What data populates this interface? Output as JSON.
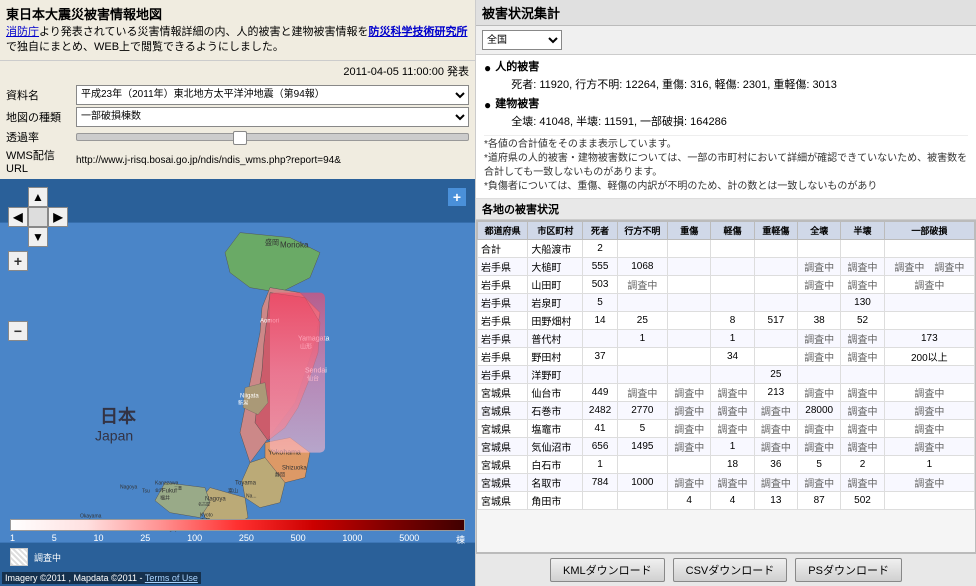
{
  "app": {
    "title": "東日本大震災被害情報地図",
    "description_part1": "消防庁",
    "description_part2": "より発表されている災害情報詳細の内、人的被害と建物被害情報を",
    "description_part3": "防災科学技術研究所",
    "description_part4": "で独自にまとめ、WEB上で閲覧できるようにしました。",
    "date_line": "2011-04-05 11:00:00 発表",
    "form": {
      "data_name_label": "資料名",
      "data_name_value": "平成23年（2011年）東北地方太平洋沖地震（第94報）",
      "map_type_label": "地図の種類",
      "map_type_value": "一部破損棟数",
      "transparency_label": "透過率",
      "wms_label": "WMS配信URL",
      "wms_url": "http://www.j-risq.bosai.go.jp/ndis/ndis_wms.php?report=94&"
    },
    "imagery_credit": "Imagery ©2011 , Mapdata ©2011 - ",
    "terms_link": "Terms of Use",
    "legend_labels": [
      "1",
      "5",
      "10",
      "25",
      "100",
      "250",
      "500",
      "1000",
      "5000",
      "棟"
    ],
    "legend_investigating": "調査中"
  },
  "stats": {
    "header": "被害状況集計",
    "filter_label": "全国",
    "human_damage_header": "人的被害",
    "human_damage_detail": "死者: 11920, 行方不明: 12264, 重傷: 316, 軽傷: 2301, 重軽傷: 3013",
    "building_damage_header": "建物被害",
    "building_damage_detail": "全壊: 41048, 半壊: 11591, 一部破損: 164286",
    "notes": [
      "*各値の合計値をそのまま表示しています。",
      "*道府県の人的被害・建物被害数については、一部の市町村において詳細が確認できていないため、被害数を合計しても一致しないものがあります。",
      "*負傷者については、重傷、軽傷の内訳が不明のため、計の数とは一致しないものがあり"
    ],
    "table_header": "各地の被害状況",
    "columns": [
      "都道府県",
      "市区町村",
      "死者",
      "行方不明",
      "重傷",
      "軽傷",
      "重軽傷",
      "全壊",
      "半壊",
      "一部破損"
    ],
    "rows": [
      [
        "合計",
        "大船渡市",
        "2",
        "",
        "",
        "",
        "",
        "",
        "",
        ""
      ],
      [
        "岩手県",
        "大槌町",
        "555",
        "1068",
        "",
        "",
        "",
        "調査中",
        "調査中",
        "調査中　調査中"
      ],
      [
        "岩手県",
        "山田町",
        "503",
        "調査中",
        "",
        "",
        "",
        "調査中",
        "調査中",
        "調査中"
      ],
      [
        "岩手県",
        "岩泉町",
        "5",
        "",
        "",
        "",
        "",
        "",
        "130",
        ""
      ],
      [
        "岩手県",
        "田野畑村",
        "14",
        "25",
        "",
        "8",
        "517",
        "38",
        "52",
        ""
      ],
      [
        "岩手県",
        "普代村",
        "",
        "1",
        "",
        "1",
        "",
        "調査中",
        "調査中",
        "173"
      ],
      [
        "岩手県",
        "野田村",
        "37",
        "",
        "",
        "34",
        "",
        "調査中",
        "調査中",
        "200以上"
      ],
      [
        "岩手県",
        "洋野町",
        "",
        "",
        "",
        "",
        "25",
        "",
        "",
        ""
      ],
      [
        "宮城県",
        "仙台市",
        "449",
        "調査中",
        "調査中",
        "調査中",
        "213",
        "調査中",
        "調査中",
        "調査中"
      ],
      [
        "宮城県",
        "石巻市",
        "2482",
        "2770",
        "調査中",
        "調査中",
        "調査中",
        "28000",
        "調査中",
        "調査中"
      ],
      [
        "宮城県",
        "塩竈市",
        "41",
        "5",
        "調査中",
        "調査中",
        "調査中",
        "調査中",
        "調査中",
        "調査中"
      ],
      [
        "宮城県",
        "気仙沼市",
        "656",
        "1495",
        "調査中",
        "1",
        "調査中",
        "調査中",
        "調査中",
        "調査中"
      ],
      [
        "宮城県",
        "白石市",
        "1",
        "",
        "",
        "18",
        "36",
        "5",
        "2",
        "1"
      ],
      [
        "宮城県",
        "名取市",
        "784",
        "1000",
        "調査中",
        "調査中",
        "調査中",
        "調査中",
        "調査中",
        "調査中"
      ],
      [
        "宮城県",
        "角田市",
        "",
        "",
        "4",
        "4",
        "13",
        "87",
        "502",
        ""
      ]
    ],
    "buttons": {
      "kml": "KMLダウンロード",
      "csv": "CSVダウンロード",
      "ps": "PSダウンロード"
    }
  }
}
